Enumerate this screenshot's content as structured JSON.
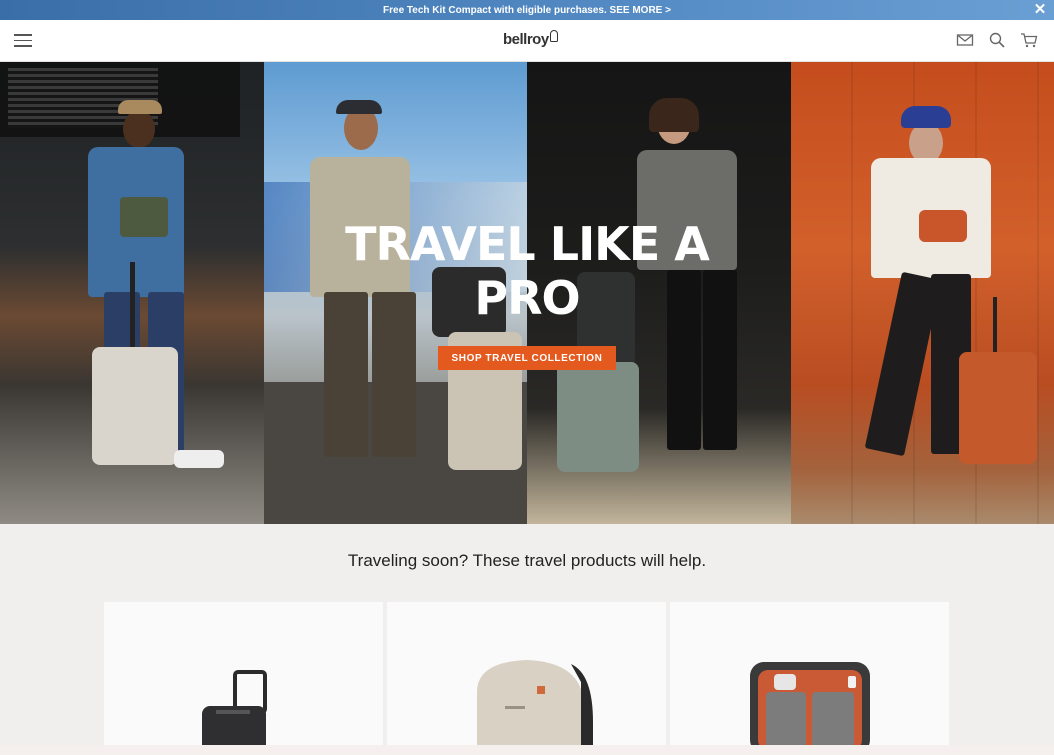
{
  "promo": {
    "text": "Free Tech Kit Compact with eligible purchases. SEE MORE >",
    "close": "✕"
  },
  "header": {
    "logo": "bellroy",
    "icons": [
      "menu-icon",
      "mail-icon",
      "search-icon",
      "cart-icon"
    ]
  },
  "hero": {
    "title": "TRAVEL LIKE A PRO",
    "cta": "SHOP TRAVEL COLLECTION"
  },
  "products": {
    "heading": "Traveling soon? These travel products will help.",
    "items": [
      "carry-on-suitcase",
      "travel-backpack",
      "tech-kit-organizer"
    ]
  },
  "colors": {
    "accent": "#e4591d",
    "promo": "#4f86c0"
  }
}
